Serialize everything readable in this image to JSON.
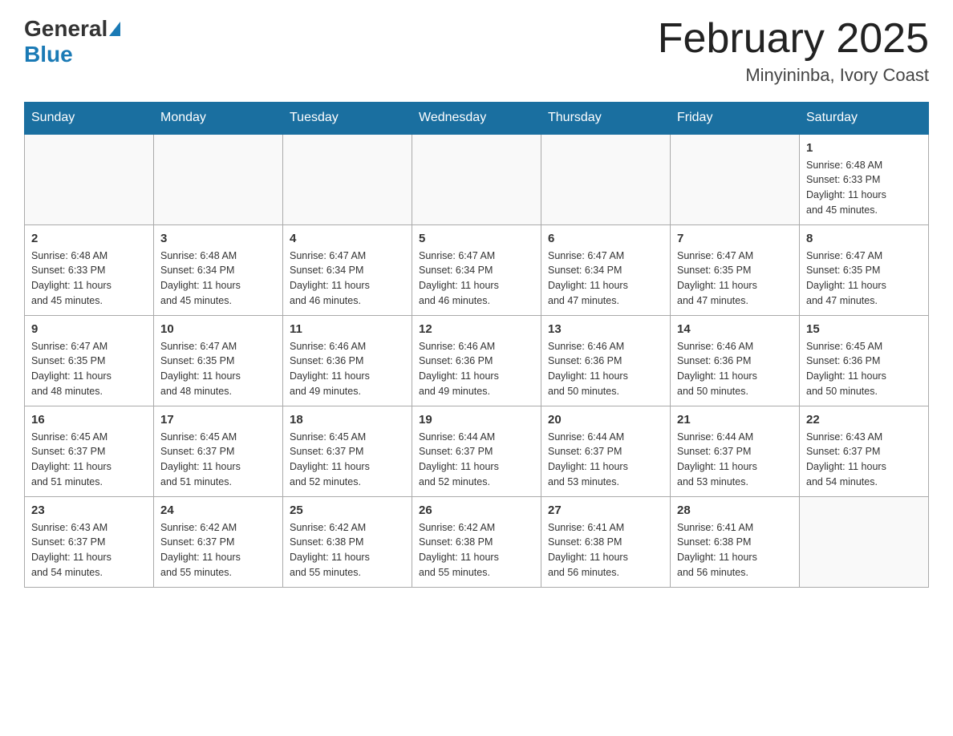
{
  "header": {
    "logo_general": "General",
    "logo_blue": "Blue",
    "month_title": "February 2025",
    "location": "Minyininba, Ivory Coast"
  },
  "days_of_week": [
    "Sunday",
    "Monday",
    "Tuesday",
    "Wednesday",
    "Thursday",
    "Friday",
    "Saturday"
  ],
  "weeks": [
    [
      {
        "day": "",
        "info": ""
      },
      {
        "day": "",
        "info": ""
      },
      {
        "day": "",
        "info": ""
      },
      {
        "day": "",
        "info": ""
      },
      {
        "day": "",
        "info": ""
      },
      {
        "day": "",
        "info": ""
      },
      {
        "day": "1",
        "info": "Sunrise: 6:48 AM\nSunset: 6:33 PM\nDaylight: 11 hours\nand 45 minutes."
      }
    ],
    [
      {
        "day": "2",
        "info": "Sunrise: 6:48 AM\nSunset: 6:33 PM\nDaylight: 11 hours\nand 45 minutes."
      },
      {
        "day": "3",
        "info": "Sunrise: 6:48 AM\nSunset: 6:34 PM\nDaylight: 11 hours\nand 45 minutes."
      },
      {
        "day": "4",
        "info": "Sunrise: 6:47 AM\nSunset: 6:34 PM\nDaylight: 11 hours\nand 46 minutes."
      },
      {
        "day": "5",
        "info": "Sunrise: 6:47 AM\nSunset: 6:34 PM\nDaylight: 11 hours\nand 46 minutes."
      },
      {
        "day": "6",
        "info": "Sunrise: 6:47 AM\nSunset: 6:34 PM\nDaylight: 11 hours\nand 47 minutes."
      },
      {
        "day": "7",
        "info": "Sunrise: 6:47 AM\nSunset: 6:35 PM\nDaylight: 11 hours\nand 47 minutes."
      },
      {
        "day": "8",
        "info": "Sunrise: 6:47 AM\nSunset: 6:35 PM\nDaylight: 11 hours\nand 47 minutes."
      }
    ],
    [
      {
        "day": "9",
        "info": "Sunrise: 6:47 AM\nSunset: 6:35 PM\nDaylight: 11 hours\nand 48 minutes."
      },
      {
        "day": "10",
        "info": "Sunrise: 6:47 AM\nSunset: 6:35 PM\nDaylight: 11 hours\nand 48 minutes."
      },
      {
        "day": "11",
        "info": "Sunrise: 6:46 AM\nSunset: 6:36 PM\nDaylight: 11 hours\nand 49 minutes."
      },
      {
        "day": "12",
        "info": "Sunrise: 6:46 AM\nSunset: 6:36 PM\nDaylight: 11 hours\nand 49 minutes."
      },
      {
        "day": "13",
        "info": "Sunrise: 6:46 AM\nSunset: 6:36 PM\nDaylight: 11 hours\nand 50 minutes."
      },
      {
        "day": "14",
        "info": "Sunrise: 6:46 AM\nSunset: 6:36 PM\nDaylight: 11 hours\nand 50 minutes."
      },
      {
        "day": "15",
        "info": "Sunrise: 6:45 AM\nSunset: 6:36 PM\nDaylight: 11 hours\nand 50 minutes."
      }
    ],
    [
      {
        "day": "16",
        "info": "Sunrise: 6:45 AM\nSunset: 6:37 PM\nDaylight: 11 hours\nand 51 minutes."
      },
      {
        "day": "17",
        "info": "Sunrise: 6:45 AM\nSunset: 6:37 PM\nDaylight: 11 hours\nand 51 minutes."
      },
      {
        "day": "18",
        "info": "Sunrise: 6:45 AM\nSunset: 6:37 PM\nDaylight: 11 hours\nand 52 minutes."
      },
      {
        "day": "19",
        "info": "Sunrise: 6:44 AM\nSunset: 6:37 PM\nDaylight: 11 hours\nand 52 minutes."
      },
      {
        "day": "20",
        "info": "Sunrise: 6:44 AM\nSunset: 6:37 PM\nDaylight: 11 hours\nand 53 minutes."
      },
      {
        "day": "21",
        "info": "Sunrise: 6:44 AM\nSunset: 6:37 PM\nDaylight: 11 hours\nand 53 minutes."
      },
      {
        "day": "22",
        "info": "Sunrise: 6:43 AM\nSunset: 6:37 PM\nDaylight: 11 hours\nand 54 minutes."
      }
    ],
    [
      {
        "day": "23",
        "info": "Sunrise: 6:43 AM\nSunset: 6:37 PM\nDaylight: 11 hours\nand 54 minutes."
      },
      {
        "day": "24",
        "info": "Sunrise: 6:42 AM\nSunset: 6:37 PM\nDaylight: 11 hours\nand 55 minutes."
      },
      {
        "day": "25",
        "info": "Sunrise: 6:42 AM\nSunset: 6:38 PM\nDaylight: 11 hours\nand 55 minutes."
      },
      {
        "day": "26",
        "info": "Sunrise: 6:42 AM\nSunset: 6:38 PM\nDaylight: 11 hours\nand 55 minutes."
      },
      {
        "day": "27",
        "info": "Sunrise: 6:41 AM\nSunset: 6:38 PM\nDaylight: 11 hours\nand 56 minutes."
      },
      {
        "day": "28",
        "info": "Sunrise: 6:41 AM\nSunset: 6:38 PM\nDaylight: 11 hours\nand 56 minutes."
      },
      {
        "day": "",
        "info": ""
      }
    ]
  ]
}
